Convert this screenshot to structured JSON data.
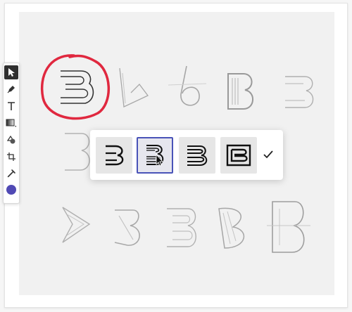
{
  "colors": {
    "accent": "#4953b8",
    "current_color": "#5049b4",
    "highlight_circle": "#e0283f",
    "sketch_stroke": "#9a9a9a"
  },
  "toolbar": {
    "tools": [
      {
        "name": "select",
        "icon": "cursor-arrow-icon",
        "active": true
      },
      {
        "name": "pen",
        "icon": "pen-nib-icon",
        "active": false
      },
      {
        "name": "text",
        "icon": "text-t-icon",
        "active": false
      },
      {
        "name": "gradient",
        "icon": "gradient-fill-icon",
        "active": false
      },
      {
        "name": "shapes",
        "icon": "shapes-icon",
        "active": false
      },
      {
        "name": "crop",
        "icon": "crop-icon",
        "active": false
      },
      {
        "name": "eyedropper",
        "icon": "eyedropper-icon",
        "active": false
      },
      {
        "name": "color",
        "icon": "color-swatch",
        "active": false
      }
    ]
  },
  "suggestion_picker": {
    "options": [
      {
        "name": "option-rounded-b",
        "selected": false
      },
      {
        "name": "option-striped-b",
        "selected": true
      },
      {
        "name": "option-lined-b",
        "selected": false
      },
      {
        "name": "option-boxed-b",
        "selected": false
      }
    ],
    "confirm_icon": "check-icon"
  }
}
